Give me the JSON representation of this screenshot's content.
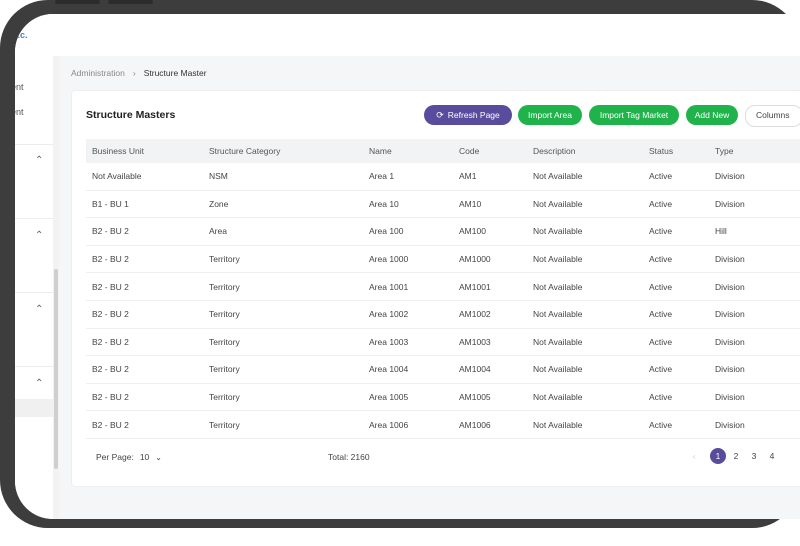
{
  "brand_fragment": "..c.",
  "sidebar": {
    "items": [
      "ent",
      "ent"
    ]
  },
  "breadcrumb": {
    "parent": "Administration",
    "separator": "›",
    "current": "Structure Master"
  },
  "card": {
    "title": "Structure Masters",
    "buttons": {
      "refresh": "Refresh Page",
      "import_area": "Import Area",
      "import_tag_market": "Import Tag Market",
      "add_new": "Add New",
      "columns": "Columns"
    }
  },
  "table": {
    "headers": [
      "Business Unit",
      "Structure Category",
      "Name",
      "Code",
      "Description",
      "Status",
      "Type"
    ],
    "rows": [
      [
        "Not Available",
        "NSM",
        "Area 1",
        "AM1",
        "Not Available",
        "Active",
        "Division"
      ],
      [
        "B1 - BU 1",
        "Zone",
        "Area 10",
        "AM10",
        "Not Available",
        "Active",
        "Division"
      ],
      [
        "B2 - BU 2",
        "Area",
        "Area 100",
        "AM100",
        "Not Available",
        "Active",
        "Hill"
      ],
      [
        "B2 - BU 2",
        "Territory",
        "Area 1000",
        "AM1000",
        "Not Available",
        "Active",
        "Division"
      ],
      [
        "B2 - BU 2",
        "Territory",
        "Area 1001",
        "AM1001",
        "Not Available",
        "Active",
        "Division"
      ],
      [
        "B2 - BU 2",
        "Territory",
        "Area 1002",
        "AM1002",
        "Not Available",
        "Active",
        "Division"
      ],
      [
        "B2 - BU 2",
        "Territory",
        "Area 1003",
        "AM1003",
        "Not Available",
        "Active",
        "Division"
      ],
      [
        "B2 - BU 2",
        "Territory",
        "Area 1004",
        "AM1004",
        "Not Available",
        "Active",
        "Division"
      ],
      [
        "B2 - BU 2",
        "Territory",
        "Area 1005",
        "AM1005",
        "Not Available",
        "Active",
        "Division"
      ],
      [
        "B2 - BU 2",
        "Territory",
        "Area 1006",
        "AM1006",
        "Not Available",
        "Active",
        "Division"
      ]
    ]
  },
  "footer": {
    "per_page_label": "Per Page:",
    "per_page_value": "10",
    "total_label": "Total: 2160",
    "pages": [
      "1",
      "2",
      "3",
      "4"
    ],
    "current_page": "1"
  },
  "colors": {
    "primary_purple": "#5a4c9c",
    "action_green": "#20b34c",
    "device_frame": "#3d3d3d"
  },
  "icons": {
    "refresh": "refresh-icon",
    "chevron": "chevron-up-icon",
    "dropdown": "chevron-down-icon",
    "prev": "chevron-left-icon"
  }
}
